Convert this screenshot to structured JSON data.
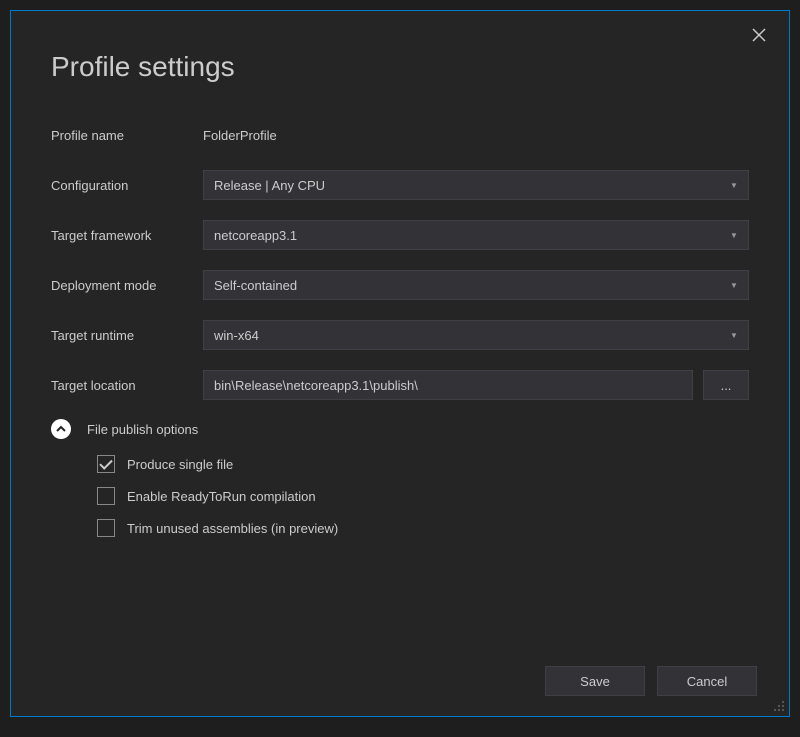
{
  "title": "Profile settings",
  "fields": {
    "profile_name": {
      "label": "Profile name",
      "value": "FolderProfile"
    },
    "configuration": {
      "label": "Configuration",
      "value": "Release | Any CPU"
    },
    "target_framework": {
      "label": "Target framework",
      "value": "netcoreapp3.1"
    },
    "deployment_mode": {
      "label": "Deployment mode",
      "value": "Self-contained"
    },
    "target_runtime": {
      "label": "Target runtime",
      "value": "win-x64"
    },
    "target_location": {
      "label": "Target location",
      "value": "bin\\Release\\netcoreapp3.1\\publish\\"
    }
  },
  "browse_label": "...",
  "expander": {
    "label": "File publish options"
  },
  "checkboxes": {
    "produce_single_file": {
      "label": "Produce single file",
      "checked": true
    },
    "enable_r2r": {
      "label": "Enable ReadyToRun compilation",
      "checked": false
    },
    "trim_unused": {
      "label": "Trim unused assemblies (in preview)",
      "checked": false
    }
  },
  "buttons": {
    "save": "Save",
    "cancel": "Cancel"
  }
}
